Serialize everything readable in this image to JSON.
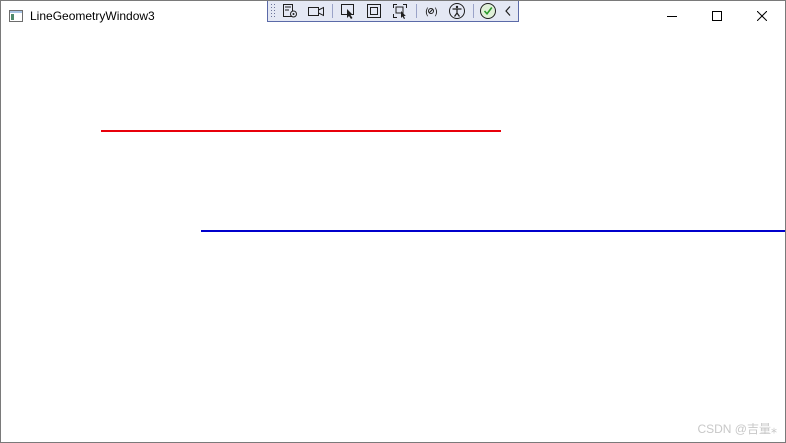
{
  "window": {
    "title": "LineGeometryWindow3",
    "icon": "app-window-icon"
  },
  "caption_buttons": {
    "minimize_icon": "minimize-icon",
    "maximize_icon": "maximize-icon",
    "close_icon": "close-icon"
  },
  "debug_toolbar": {
    "items": [
      "go-to-live-visual-tree-icon",
      "record-icon",
      "select-element-icon",
      "display-layout-adorners-icon",
      "track-focused-element-icon",
      "binding-failures-icon",
      "accessibility-checker-icon",
      "checks-passed-icon",
      "collapse-toolbar-icon"
    ]
  },
  "content": {
    "lines": [
      {
        "name": "red-line",
        "stroke": "#e8000b"
      },
      {
        "name": "blue-line",
        "stroke": "#0000cc"
      }
    ]
  },
  "watermark": "CSDN @吉量⁎"
}
